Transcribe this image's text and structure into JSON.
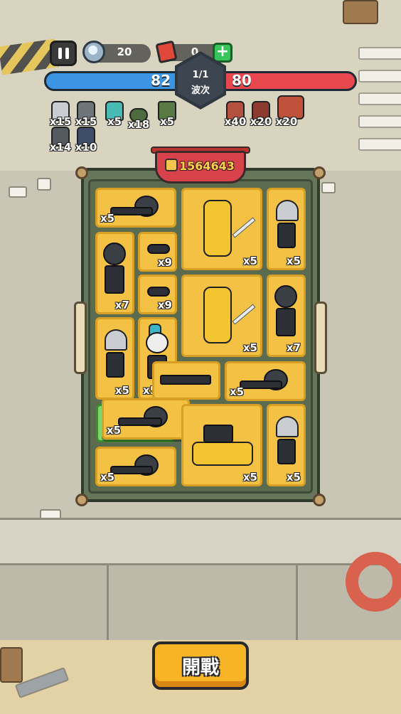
{
  "hud": {
    "gems": "20",
    "tickets": "0",
    "plus_label": "+",
    "player_hp": "82",
    "enemy_hp": "80",
    "wave_progress": "1/1",
    "wave_label": "波次"
  },
  "player_army": [
    {
      "count": "x15",
      "icon": "silver-hair-soldier-icon"
    },
    {
      "count": "x15",
      "icon": "swordsman-icon"
    },
    {
      "count": "x5",
      "icon": "teal-hair-soldier-icon"
    },
    {
      "count": "x18",
      "icon": "green-drone-icon"
    },
    {
      "count": "x5",
      "icon": "green-tank-icon"
    },
    {
      "count": "x14",
      "icon": "gunner-icon"
    },
    {
      "count": "x10",
      "icon": "mech-warrior-icon"
    }
  ],
  "enemy_army": [
    {
      "count": "x40",
      "icon": "red-soldier-icon"
    },
    {
      "count": "x20",
      "icon": "red-brute-icon"
    },
    {
      "count": "x20",
      "icon": "red-tank-icon"
    }
  ],
  "board": {
    "power": "1564643",
    "cells": [
      {
        "id": "crawler-a",
        "count": "x5"
      },
      {
        "id": "mech-knight-a",
        "count": "x5"
      },
      {
        "id": "silver-swordsman-a",
        "count": "x5"
      },
      {
        "id": "masked-soldier-a",
        "count": "x7"
      },
      {
        "id": "drone-a",
        "count": "x9"
      },
      {
        "id": "drone-b",
        "count": "x9"
      },
      {
        "id": "mech-knight-b",
        "count": "x5"
      },
      {
        "id": "masked-soldier-b",
        "count": "x7"
      },
      {
        "id": "silver-swordsman-b",
        "count": "x5"
      },
      {
        "id": "mohawk-gunner",
        "count": "x5"
      },
      {
        "id": "crawler-b",
        "count": "x5"
      },
      {
        "id": "crawler-dragging",
        "count": "x5"
      },
      {
        "id": "tank",
        "count": "x5"
      },
      {
        "id": "silver-swordsman-c",
        "count": "x5"
      },
      {
        "id": "crawler-c",
        "count": "x5"
      }
    ]
  },
  "start_button": {
    "label": "開戰"
  },
  "colors": {
    "player_bar": "#3b95e3",
    "enemy_bar": "#e8474d",
    "cell_fill": "#f3c244",
    "start_button": "#f7b425",
    "board": "#66765a"
  }
}
